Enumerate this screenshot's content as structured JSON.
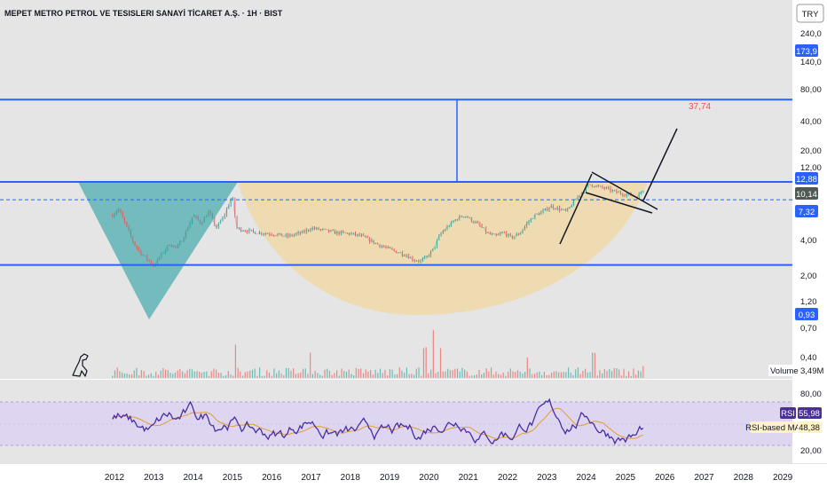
{
  "header": {
    "title": "MEPET METRO PETROL VE TESISLERI SANAYİ TİCARET A.Ş. · 1H · BIST",
    "currency": "TRY"
  },
  "colors": {
    "background": "#e5e5e5",
    "rsi_band": "#ded5f0",
    "level_line": "#2962ff",
    "cup_fill": "#f0d9a8",
    "left_triangle": "#66b6b8",
    "candle_up": "#26a69a",
    "candle_down": "#ef5350",
    "rsi_line": "#4a2e9e",
    "rsi_ma": "#e0a030",
    "target_label": "#f05050"
  },
  "price_axis": {
    "ticks": [
      "240,0",
      "140,0",
      "80,00",
      "40,00",
      "20,00",
      "12,00",
      "4,00",
      "2,00",
      "1,20",
      "0,70",
      "0,40"
    ]
  },
  "price_tags": [
    {
      "label": "173,9",
      "kind": "level"
    },
    {
      "label": "12,88",
      "kind": "level"
    },
    {
      "label": "10,14",
      "kind": "last"
    },
    {
      "label": "7,32",
      "kind": "level"
    },
    {
      "label": "0,93",
      "kind": "level"
    }
  ],
  "annotations": {
    "target_label": "37,74"
  },
  "volume": {
    "label": "Volume",
    "value": "3,49M"
  },
  "rsi": {
    "label": "RSI",
    "value": "55,98",
    "ma_label": "RSI-based MA",
    "ma_value": "48,38",
    "ticks": [
      "80,00",
      "20,00"
    ]
  },
  "chart_data": {
    "type": "line",
    "title": "MEPET METRO PETROL VE TESISLERI SANAYİ TİCARET A.Ş. · 1H · BIST",
    "x_ticks": [
      "2012",
      "2013",
      "2014",
      "2015",
      "2016",
      "2017",
      "2018",
      "2019",
      "2020",
      "2021",
      "2022",
      "2023",
      "2024",
      "2025",
      "2026",
      "2027",
      "2028",
      "2029"
    ],
    "y_scale": "log",
    "ylim": [
      0.3,
      270
    ],
    "horizontal_levels": [
      173.9,
      12.88,
      7.32,
      0.93
    ],
    "last_price": 10.14,
    "target": 37.74,
    "series": [
      {
        "x": [
          2011.95,
          2012.1,
          2012.3,
          2012.5,
          2012.7,
          2012.85,
          2013.0,
          2013.2,
          2013.4,
          2013.6,
          2013.8,
          2014.0,
          2014.2,
          2014.4,
          2014.6,
          2014.8,
          2015.0,
          2015.1,
          2015.3,
          2015.6,
          2016.0,
          2016.4,
          2016.8,
          2017.0,
          2017.3,
          2017.6,
          2018.0,
          2018.3,
          2018.6,
          2018.9,
          2019.2,
          2019.4,
          2019.6,
          2019.8,
          2019.95,
          2020.1,
          2020.3,
          2020.5,
          2020.7,
          2020.9,
          2021.1,
          2021.3,
          2021.5,
          2021.7,
          2021.9,
          2022.1,
          2022.3,
          2022.5,
          2022.7,
          2022.9,
          2023.1,
          2023.3,
          2023.5,
          2023.7,
          2023.9,
          2024.1,
          2024.3,
          2024.5,
          2024.7,
          2024.9,
          2025.1,
          2025.3,
          2025.45
        ],
        "values": [
          4.5,
          5.5,
          3.2,
          1.8,
          1.3,
          1.1,
          0.9,
          1.3,
          1.8,
          1.6,
          2.5,
          4.5,
          3.5,
          5.0,
          3.0,
          4.5,
          8.5,
          3.0,
          2.8,
          2.6,
          2.5,
          2.3,
          2.6,
          3.0,
          2.8,
          2.6,
          2.5,
          2.3,
          1.9,
          1.6,
          1.4,
          1.3,
          1.1,
          1.05,
          1.2,
          1.5,
          2.5,
          3.2,
          4.0,
          4.5,
          3.8,
          3.2,
          2.5,
          2.3,
          2.6,
          2.2,
          2.5,
          3.5,
          4.5,
          5.0,
          6.0,
          5.5,
          5.0,
          7.0,
          9.5,
          12.0,
          11.0,
          10.5,
          9.5,
          9.0,
          8.5,
          8.0,
          10.14
        ]
      }
    ]
  }
}
